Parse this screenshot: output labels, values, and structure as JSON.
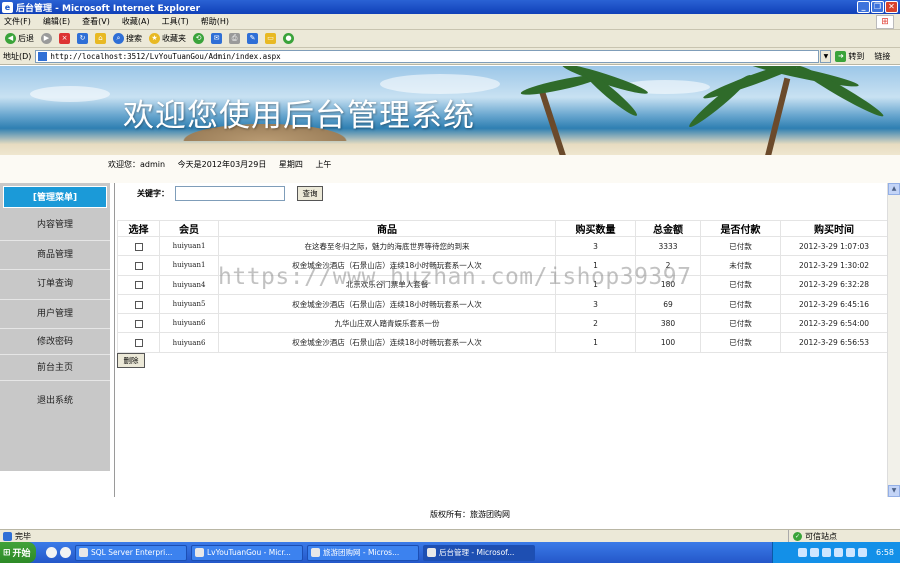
{
  "window": {
    "title": "后台管理 - Microsoft Internet Explorer",
    "buttons": [
      "_",
      "❐",
      "✕"
    ]
  },
  "menu": [
    "文件(F)",
    "编辑(E)",
    "查看(V)",
    "收藏(A)",
    "工具(T)",
    "帮助(H)"
  ],
  "toolbar": {
    "back": "后退",
    "search": "搜索",
    "favorites": "收藏夹"
  },
  "address": {
    "label": "地址(D)",
    "url": "http://localhost:3512/LvYouTuanGou/Admin/index.aspx",
    "go": "转到",
    "links": "链接"
  },
  "banner": {
    "title": "欢迎您使用后台管理系统"
  },
  "welcome": {
    "user": "欢迎您：admin",
    "date": "今天是2012年03月29日",
    "weekday": "星期四",
    "period": "上午"
  },
  "sidebar": {
    "header": "[管理菜单]",
    "items": [
      "内容管理",
      "商品管理",
      "订单查询",
      "用户管理",
      "修改密码",
      "前台主页",
      "退出系统"
    ]
  },
  "search": {
    "label": "关键字：",
    "value": "",
    "button": "查询"
  },
  "table": {
    "headers": [
      "选择",
      "会员",
      "商品",
      "购买数量",
      "总金额",
      "是否付款",
      "购买时间"
    ],
    "rows": [
      {
        "member": "huiyuan1",
        "product": "在这春至冬归之际，魅力的海底世界等待您的到来",
        "qty": "3",
        "total": "3333",
        "paid": "已付款",
        "time": "2012-3-29 1:07:03"
      },
      {
        "member": "huiyuan1",
        "product": "权金城金沙酒店（石景山店）连续18小时畅玩套系一人次",
        "qty": "1",
        "total": "2",
        "paid": "未付款",
        "time": "2012-3-29 1:30:02"
      },
      {
        "member": "huiyuan4",
        "product": "北京欢乐谷门票单人套餐",
        "qty": "1",
        "total": "180",
        "paid": "已付款",
        "time": "2012-3-29 6:32:28"
      },
      {
        "member": "huiyuan5",
        "product": "权金城金沙酒店（石景山店）连续18小时畅玩套系一人次",
        "qty": "3",
        "total": "69",
        "paid": "已付款",
        "time": "2012-3-29 6:45:16"
      },
      {
        "member": "huiyuan6",
        "product": "九华山庄双人踏青娱乐套系一份",
        "qty": "2",
        "total": "380",
        "paid": "已付款",
        "time": "2012-3-29 6:54:00"
      },
      {
        "member": "huiyuan6",
        "product": "权金城金沙酒店（石景山店）连续18小时畅玩套系一人次",
        "qty": "1",
        "total": "100",
        "paid": "已付款",
        "time": "2012-3-29 6:56:53"
      }
    ],
    "delete_button": "删除"
  },
  "footer": "版权所有：旅游团购网",
  "watermark": "https://www.huzhan.com/ishop39397",
  "statusbar": {
    "status": "完毕",
    "zone": "可信站点"
  },
  "taskbar": {
    "start": "开始",
    "tasks": [
      "SQL Server Enterpri...",
      "LvYouTuanGou - Micr...",
      "旅游团购网 - Micros...",
      "后台管理 - Microsof..."
    ],
    "clock": "6:58"
  }
}
